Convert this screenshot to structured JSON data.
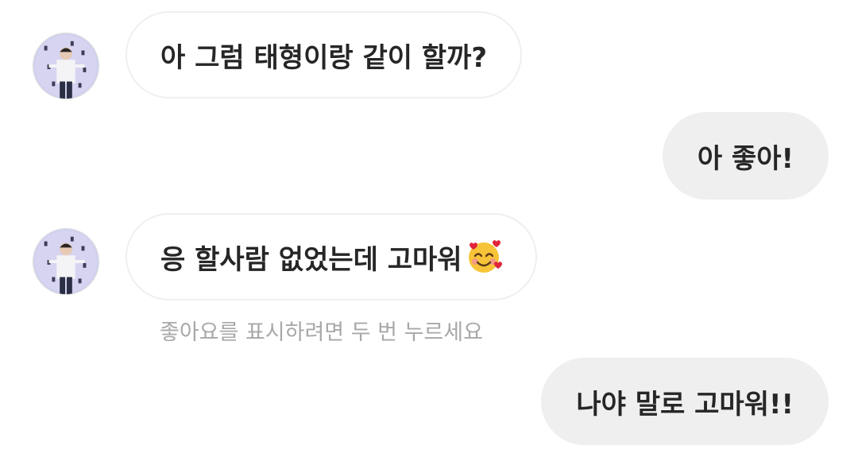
{
  "messages": [
    {
      "sender": "other",
      "text": "아 그럼 태형이랑 같이 할까?"
    },
    {
      "sender": "me",
      "text": "아 좋아!"
    },
    {
      "sender": "other",
      "text": "응 할사람 없었는데 고마워",
      "emoji": "smiling-face-with-hearts"
    },
    {
      "sender": "me",
      "text": "나야 말로 고마워!!"
    }
  ],
  "like_hint": "좋아요를 표시하려면 두 번 누르세요",
  "colors": {
    "incoming_bubble_bg": "#ffffff",
    "incoming_bubble_border": "#efefef",
    "outgoing_bubble_bg": "#efefef",
    "message_text": "#262626",
    "hint_text": "#a8a8a8"
  }
}
